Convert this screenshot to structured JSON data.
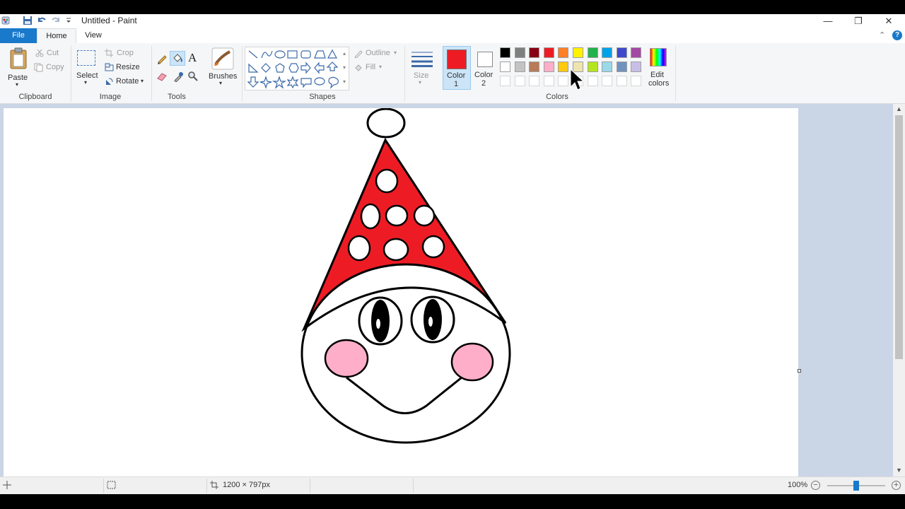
{
  "window": {
    "title": "Untitled - Paint"
  },
  "tabs": {
    "file": "File",
    "home": "Home",
    "view": "View"
  },
  "clipboard": {
    "paste": "Paste",
    "cut": "Cut",
    "copy": "Copy",
    "group": "Clipboard"
  },
  "image": {
    "select": "Select",
    "crop": "Crop",
    "resize": "Resize",
    "rotate": "Rotate",
    "group": "Image"
  },
  "tools": {
    "group": "Tools",
    "brushes": "Brushes"
  },
  "shapes": {
    "outline": "Outline",
    "fill": "Fill",
    "group": "Shapes"
  },
  "size": {
    "label": "Size"
  },
  "colors": {
    "color1_label": "Color",
    "color1_num": "1",
    "color2_label": "Color",
    "color2_num": "2",
    "edit_label": "Edit",
    "edit_label2": "colors",
    "group": "Colors",
    "color1_value": "#ed1c24",
    "color2_value": "#ffffff",
    "palette_row1": [
      "#000000",
      "#7f7f7f",
      "#880015",
      "#ed1c24",
      "#ff7f27",
      "#fff200",
      "#22b14c",
      "#00a2e8",
      "#3f48cc",
      "#a349a4"
    ],
    "palette_row2": [
      "#ffffff",
      "#c3c3c3",
      "#b97a57",
      "#ffaec9",
      "#ffc90e",
      "#efe4b0",
      "#b5e61d",
      "#99d9ea",
      "#7092be",
      "#c8bfe7"
    ]
  },
  "status": {
    "dimensions": "1200 × 797px",
    "zoom": "100%",
    "zoom_level": 0.5
  },
  "drawing": {
    "hat_color": "#ed1c24",
    "cheek_color": "#ffaec9",
    "outline_color": "#000000"
  }
}
